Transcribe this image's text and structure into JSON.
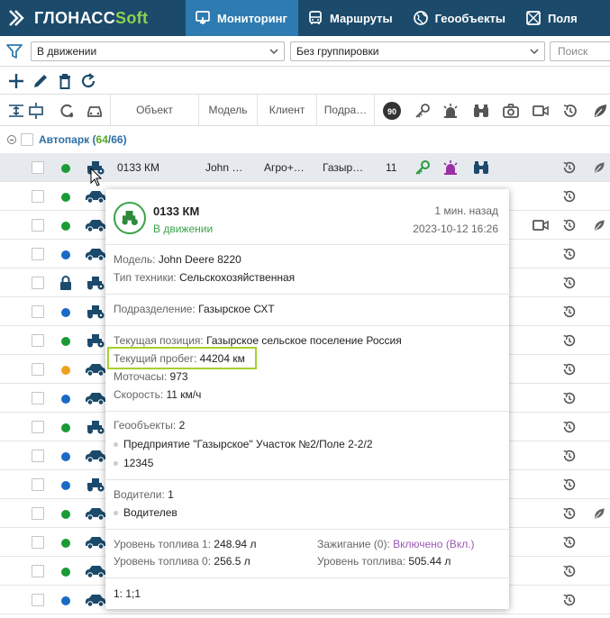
{
  "brand": {
    "name_main": "ГЛОНАСС",
    "name_soft": "Soft"
  },
  "nav": [
    {
      "label": "Мониторинг",
      "active": true
    },
    {
      "label": "Маршруты"
    },
    {
      "label": "Геообъекты"
    },
    {
      "label": "Поля"
    }
  ],
  "filters": {
    "state_select": "В движении",
    "group_select": "Без группировки",
    "search_placeholder": "Поиск"
  },
  "table": {
    "columns": [
      "Объект",
      "Модель",
      "Клиент",
      "Подра…"
    ],
    "speed_badge": "90"
  },
  "group": {
    "name": "Автопарк",
    "count_open": "64",
    "count_total": "66"
  },
  "rows": [
    {
      "status": "#1a9b35",
      "object": "0133 КМ",
      "model": "John …",
      "client": "Агро+…",
      "division": "Газыр…",
      "speed": "11",
      "selected": true
    },
    {
      "status": "#1a9b35"
    },
    {
      "status": "#1a9b35"
    },
    {
      "status": "#1a6ac6"
    },
    {
      "status": "locked"
    },
    {
      "status": "#1a6ac6"
    },
    {
      "status": "#1a9b35"
    },
    {
      "status": "#f0a020"
    },
    {
      "status": "#1a6ac6"
    },
    {
      "status": "#1a9b35"
    },
    {
      "status": "#1a6ac6"
    },
    {
      "status": "#1a6ac6"
    },
    {
      "status": "#1a9b35"
    },
    {
      "status": "#1a9b35"
    },
    {
      "status": "#1a9b35"
    },
    {
      "status": "#1a6ac6"
    }
  ],
  "popup": {
    "title": "0133 КМ",
    "status": "В движении",
    "ago": "1 мин. назад",
    "datetime": "2023-10-12 16:26",
    "model_label": "Модель:",
    "model": "John Deere 8220",
    "type_label": "Тип техники:",
    "type": "Сельскохозяйственная",
    "division_label": "Подразделение:",
    "division": "Газырское СХТ",
    "position_label": "Текущая позиция:",
    "position": "Газырское сельское поселение Россия",
    "mileage_label": "Текущий пробег:",
    "mileage": "44204 км",
    "engine_label": "Моточасы:",
    "engine": "973",
    "speed_label": "Скорость:",
    "speed": "11 км/ч",
    "geo_label": "Геообъекты:",
    "geo_count": "2",
    "geo_items": [
      "Предприятие \"Газырское\" Участок №2/Поле 2-2/2",
      "12345"
    ],
    "drivers_label": "Водители:",
    "drivers_count": "1",
    "drivers_items": [
      "Водителев"
    ],
    "fuel1_label": "Уровень топлива 1:",
    "fuel1": "248.94 л",
    "fuel0_label": "Уровень топлива 0:",
    "fuel0": "256.5 л",
    "ign_label": "Зажигание (0):",
    "ign": "Включено (Вкл.)",
    "fuel_label": "Уровень топлива:",
    "fuel": "505.44 л",
    "footer": "1: 1;1"
  },
  "colors": {
    "nav_bg": "#1b4a6b",
    "nav_active": "#2d7bb0",
    "green": "#1a9b35",
    "blue": "#1a6ac6",
    "orange": "#f0a020",
    "highlight": "#a5d12e"
  }
}
